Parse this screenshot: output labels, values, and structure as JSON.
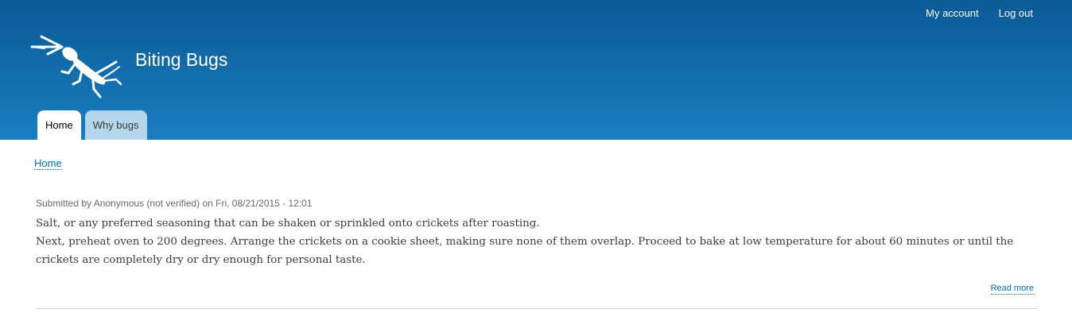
{
  "header": {
    "site_name": "Biting Bugs",
    "secondary_menu": [
      "My account",
      "Log out"
    ],
    "logo": "bug-logo-icon",
    "tabs": [
      {
        "label": "Home",
        "active": true
      },
      {
        "label": "Why bugs",
        "active": false
      }
    ]
  },
  "colors": {
    "header_top": "#0a5a96",
    "header_bottom": "#1a7ec0",
    "link": "#0071b3",
    "inactive_tab": "#b4d6ea"
  },
  "breadcrumb": "Home",
  "article": {
    "submitted": "Submitted by Anonymous (not verified) on Fri, 08/21/2015 - 12:01",
    "paragraphs": [
      "Salt, or any preferred seasoning that can be shaken or sprinkled onto crickets after roasting.",
      "Next, preheat oven to 200 degrees. Arrange the crickets on a cookie sheet, making sure none of them overlap. Proceed to bake at low temperature for about 60 minutes or until the crickets are completely dry or dry enough for personal taste."
    ],
    "read_more": "Read more"
  }
}
